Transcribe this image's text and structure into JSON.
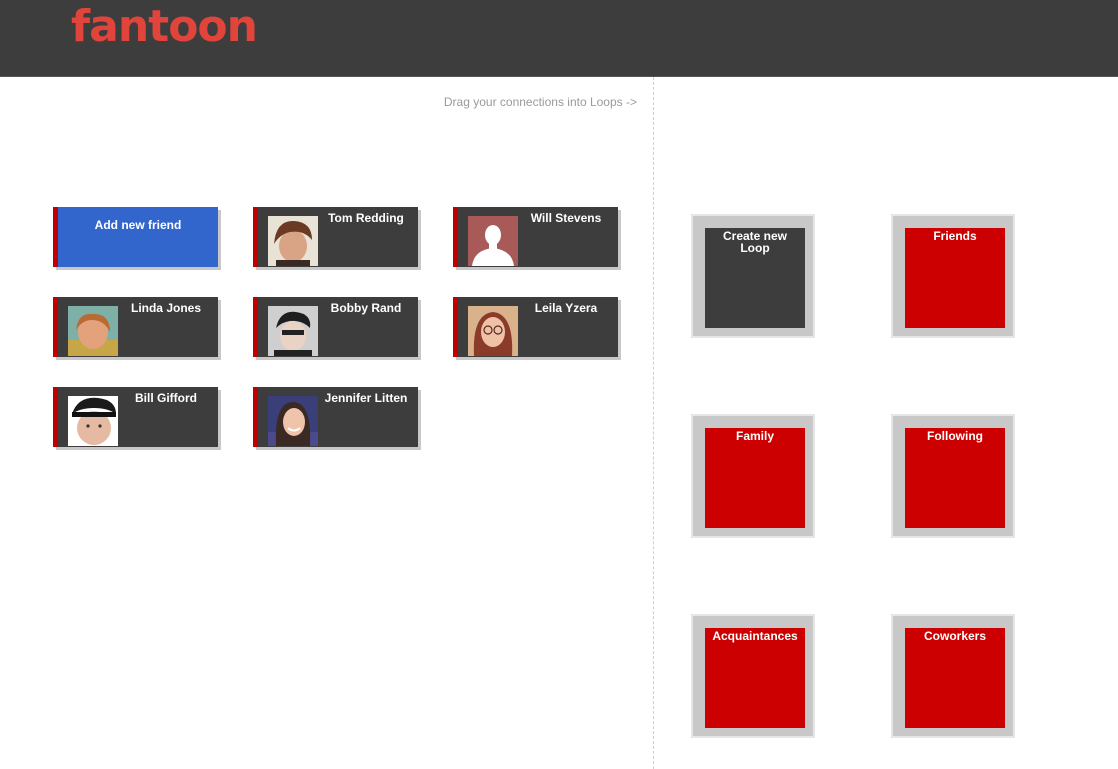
{
  "app": {
    "logo": "fantoon"
  },
  "hint": "Drag your connections into Loops ->",
  "add_friend": {
    "label": "Add new friend"
  },
  "friends": [
    {
      "name": "Tom Redding"
    },
    {
      "name": "Will Stevens"
    },
    {
      "name": "Linda Jones"
    },
    {
      "name": "Bobby Rand"
    },
    {
      "name": "Leila Yzera"
    },
    {
      "name": "Bill Gifford"
    },
    {
      "name": "Jennifer Litten"
    }
  ],
  "create_loop": {
    "label": "Create new Loop"
  },
  "loops": [
    {
      "label": "Friends"
    },
    {
      "label": "Family"
    },
    {
      "label": "Following"
    },
    {
      "label": "Acquaintances"
    },
    {
      "label": "Coworkers"
    }
  ],
  "colors": {
    "header": "#3d3d3d",
    "logo": "#e0443a",
    "card": "#3d3d3d",
    "card_accent": "#c00000",
    "add_button": "#3366cc",
    "loop_fill": "#cc0000",
    "loop_frame": "#c8c8c8"
  }
}
